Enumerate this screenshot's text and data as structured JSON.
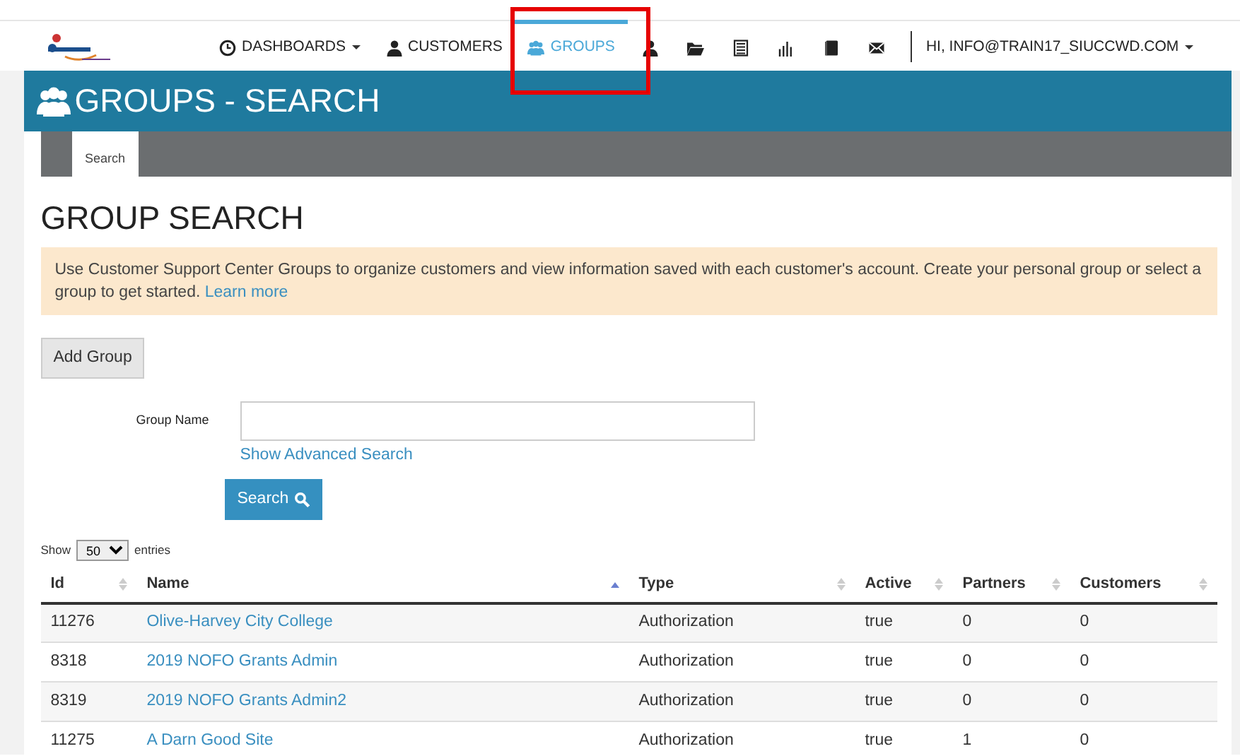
{
  "nav": {
    "items": [
      {
        "kind": "menu",
        "label": "DASHBOARDS",
        "dropdown": true,
        "selected": false
      },
      {
        "kind": "menu",
        "label": "CUSTOMERS",
        "dropdown": false,
        "selected": false
      },
      {
        "kind": "menu",
        "label": "GROUPS",
        "dropdown": false,
        "selected": true
      },
      {
        "kind": "icon",
        "selected": false
      },
      {
        "kind": "icon",
        "selected": false
      },
      {
        "kind": "icon",
        "selected": false
      },
      {
        "kind": "icon",
        "selected": false
      },
      {
        "kind": "icon",
        "selected": false
      },
      {
        "kind": "icon",
        "selected": false
      }
    ],
    "user": {
      "label": "HI, INFO@TRAIN17_SIUCCWD.COM",
      "dropdown": true
    }
  },
  "banner": {
    "title": "GROUPS - SEARCH"
  },
  "tabs": [
    {
      "label": "Search",
      "selected": true
    }
  ],
  "heading": "GROUP SEARCH",
  "alert": {
    "text": "Use Customer Support Center Groups to organize customers and view information saved with each customer's account. Create your personal group or select a group to get started.",
    "link": "Learn more"
  },
  "add_button": "Add Group",
  "search_form": {
    "label": "Group Name",
    "advanced_link": "Show Advanced Search",
    "button": "Search"
  },
  "length": {
    "before": "Show",
    "value": "50",
    "after": "entries"
  },
  "table": {
    "columns": [
      {
        "label": "Id",
        "sorted": false
      },
      {
        "label": "Name",
        "sorted": true
      },
      {
        "label": "Type",
        "sorted": false
      },
      {
        "label": "Active",
        "sorted": false
      },
      {
        "label": "Partners",
        "sorted": false
      },
      {
        "label": "Customers",
        "sorted": false
      }
    ],
    "rows": [
      [
        "11276",
        "Olive-Harvey City College",
        "Authorization",
        "true",
        "0",
        "0"
      ],
      [
        "8318",
        "2019 NOFO Grants Admin",
        "Authorization",
        "true",
        "0",
        "0"
      ],
      [
        "8319",
        "2019 NOFO Grants Admin2",
        "Authorization",
        "true",
        "0",
        "0"
      ],
      [
        "11275",
        "A Darn Good Site",
        "Authorization",
        "true",
        "1",
        "0"
      ]
    ]
  }
}
